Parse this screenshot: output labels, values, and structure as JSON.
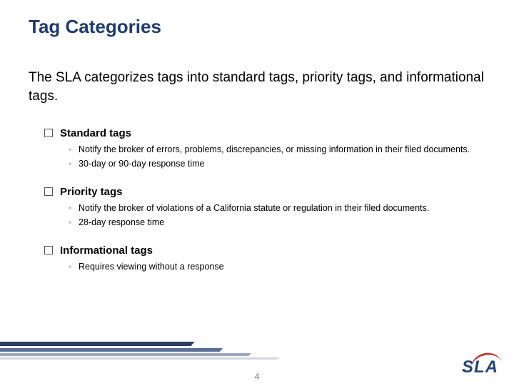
{
  "title": "Tag Categories",
  "intro": "The SLA categorizes tags into standard tags, priority tags, and informational tags.",
  "sections": [
    {
      "heading": "Standard tags",
      "bullets": [
        "Notify the broker of errors, problems, discrepancies, or missing information in their filed documents.",
        "30-day or 90-day response time"
      ]
    },
    {
      "heading": "Priority tags",
      "bullets": [
        "Notify the broker of violations of a California statute or regulation in their filed documents.",
        "28-day response time"
      ]
    },
    {
      "heading": "Informational tags",
      "bullets": [
        "Requires viewing without a response"
      ]
    }
  ],
  "page_number": "4",
  "logo_text": "SLA"
}
